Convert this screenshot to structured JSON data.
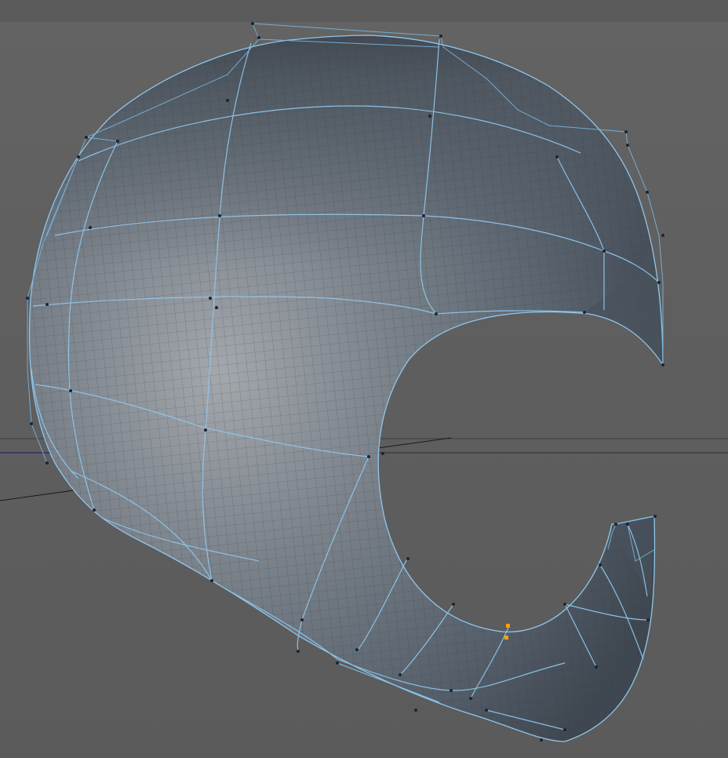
{
  "viewport": {
    "type": "3d-modeling-viewport",
    "description_visible": false,
    "background_color": "#5d5d5d",
    "mesh_color": "#56616f",
    "wire_color": "#8fc6ec",
    "cage_color": "#7ab4de",
    "vertex_color": "#1b2533",
    "selected_vertex_color": "#ffa000",
    "axis_color": "#111111"
  },
  "object": {
    "icon": "helmet-mesh-icon",
    "selected_points": 2
  }
}
